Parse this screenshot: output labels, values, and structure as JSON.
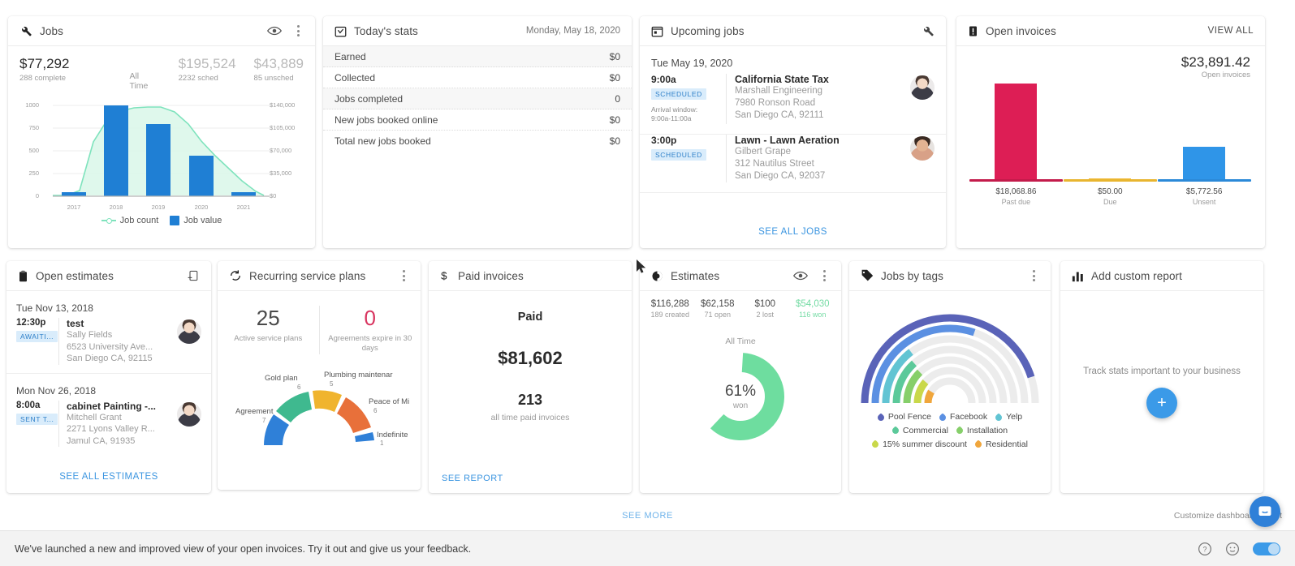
{
  "jobs": {
    "title": "Jobs",
    "icon": "wrench-icon",
    "eye_icon": "eye-icon",
    "menu_icon": "kebab-menu-icon",
    "stats": [
      {
        "value": "$77,292",
        "label": "288 complete"
      },
      {
        "value": "All Time",
        "label": ""
      },
      {
        "value": "$195,524",
        "label": "2232 sched"
      },
      {
        "value": "$43,889",
        "label": "85 unsched"
      }
    ],
    "stat_primary_value": "$77,292",
    "stat_primary_label": "288 complete",
    "stat_period": "All Time",
    "stat_sched_value": "$195,524",
    "stat_sched_label": "2232 sched",
    "stat_unsched_value": "$43,889",
    "stat_unsched_label": "85 unsched",
    "legend": {
      "line": "Job count",
      "bar": "Job value"
    }
  },
  "today": {
    "title": "Today's stats",
    "icon": "calendar-check-icon",
    "date": "Monday, May 18, 2020",
    "rows": [
      {
        "label": "Earned",
        "value": "$0"
      },
      {
        "label": "Collected",
        "value": "$0"
      },
      {
        "label": "Jobs completed",
        "value": "0"
      },
      {
        "label": "New jobs booked online",
        "value": "$0"
      },
      {
        "label": "Total new jobs booked",
        "value": "$0"
      }
    ]
  },
  "upcoming": {
    "title": "Upcoming jobs",
    "icon": "calendar-icon",
    "action_icon": "wrench-icon",
    "day": "Tue May 19, 2020",
    "items": [
      {
        "time": "9:00a",
        "status": "SCHEDULED",
        "arrival_label": "Arrival window:",
        "arrival_window": "9:00a-11:00a",
        "title": "California State Tax",
        "customer": "Marshall Engineering",
        "address1": "7980 Ronson Road",
        "address2": "San Diego CA, 92111"
      },
      {
        "time": "3:00p",
        "status": "SCHEDULED",
        "arrival_label": "",
        "arrival_window": "",
        "title": "Lawn - Lawn Aeration",
        "customer": "Gilbert Grape",
        "address1": "312 Nautilus Street",
        "address2": "San Diego CA, 92037"
      }
    ],
    "link": "SEE ALL JOBS"
  },
  "invoices": {
    "title": "Open invoices",
    "icon": "invoice-alert-icon",
    "view_all": "VIEW ALL",
    "total_value": "$23,891.42",
    "total_label": "Open invoices",
    "bars": [
      {
        "value": "$18,068.86",
        "label": "Past due",
        "color": "#dd1e55",
        "height": 118
      },
      {
        "value": "$50.00",
        "label": "Due",
        "color": "#f0bb3c",
        "height": 1
      },
      {
        "value": "$5,772.56",
        "label": "Unsent",
        "color": "#2f95e8",
        "height": 40
      }
    ]
  },
  "open_estimates": {
    "title": "Open estimates",
    "icon": "clipboard-icon",
    "action_icon": "add-clipboard-icon",
    "groups": [
      {
        "day": "Tue Nov 13, 2018",
        "time": "12:30p",
        "status": "AWAITI...",
        "title": "test",
        "customer": "Sally Fields",
        "address1": "6523 University Ave...",
        "address2": "San Diego CA, 92115"
      },
      {
        "day": "Mon Nov 26, 2018",
        "time": "8:00a",
        "status": "SENT T...",
        "title": "cabinet Painting -...",
        "customer": "Mitchell Grant",
        "address1": "2271 Lyons Valley R...",
        "address2": "Jamul CA, 91935"
      }
    ],
    "link": "SEE ALL ESTIMATES"
  },
  "recurring": {
    "title": "Recurring service plans",
    "icon": "recurring-icon",
    "menu_icon": "kebab-menu-icon",
    "active_count": "25",
    "active_label": "Active service plans",
    "expiring_count": "0",
    "expiring_label": "Agreements expire in 30 days"
  },
  "paid": {
    "title": "Paid invoices",
    "icon": "dollar-icon",
    "heading": "Paid",
    "amount": "$81,602",
    "count": "213",
    "count_label": "all time paid invoices",
    "link": "SEE REPORT"
  },
  "estimates": {
    "title": "Estimates",
    "icon": "pie-icon",
    "eye_icon": "eye-icon",
    "menu_icon": "kebab-menu-icon",
    "stats": [
      {
        "value": "$116,288",
        "label": "189 created"
      },
      {
        "value": "$62,158",
        "label": "71 open"
      },
      {
        "value": "$100",
        "label": "2 lost"
      },
      {
        "value": "$54,030",
        "label": "116 won"
      }
    ],
    "period": "All Time",
    "donut_percent": "61%",
    "donut_label": "won"
  },
  "tags": {
    "title": "Jobs by tags",
    "icon": "tag-icon",
    "menu_icon": "kebab-menu-icon",
    "legend": [
      {
        "label": "Pool Fence",
        "color": "#5a63b8"
      },
      {
        "label": "Facebook",
        "color": "#5b90e2"
      },
      {
        "label": "Yelp",
        "color": "#62c4d3"
      },
      {
        "label": "Commercial",
        "color": "#5cc99a"
      },
      {
        "label": "Installation",
        "color": "#86cf6a"
      },
      {
        "label": "15% summer discount",
        "color": "#c9d84a"
      },
      {
        "label": "Residential",
        "color": "#f0a63c"
      }
    ]
  },
  "custom": {
    "title": "Add custom report",
    "icon": "bar-chart-icon",
    "text": "Track stats important to your business",
    "add_icon": "plus-icon"
  },
  "footer": {
    "see_more": "SEE MORE",
    "customize": "Customize dashboard layout",
    "chat_icon": "chat-bubble-icon"
  },
  "banner": {
    "text": "We've launched a new and improved view of your open invoices. Try it out and give us your feedback.",
    "help_icon": "help-circle-icon",
    "feedback_icon": "smiley-icon",
    "toggle_name": "new-view-toggle"
  },
  "chart_data": [
    {
      "type": "bar",
      "title": "Jobs",
      "categories": [
        "2017",
        "2018",
        "2019",
        "2020",
        "2021"
      ],
      "series": [
        {
          "name": "Job value",
          "values": [
            3000,
            140000,
            110000,
            61000,
            2500
          ],
          "type": "bar"
        },
        {
          "name": "Job count",
          "values": [
            5,
            830,
            995,
            545,
            75
          ],
          "type": "area"
        }
      ],
      "xlabel": "",
      "ylabel": "Job count",
      "ylim": [
        0,
        1000
      ],
      "y_ticks": [
        "0",
        "250",
        "500",
        "750",
        "1000"
      ],
      "y2label": "Job value",
      "y2lim": [
        0,
        140000
      ],
      "y2_ticks": [
        "$0",
        "$35,000",
        "$70,000",
        "$105,000",
        "$140,000"
      ],
      "grid": true,
      "legend_position": "bottom"
    },
    {
      "type": "bar",
      "title": "Open invoices",
      "categories": [
        "Past due",
        "Due",
        "Unsent"
      ],
      "values": [
        18068.86,
        50.0,
        5772.56
      ],
      "value_labels": [
        "$18,068.86",
        "$50.00",
        "$5,772.56"
      ],
      "colors": [
        "#dd1e55",
        "#f0bb3c",
        "#2f95e8"
      ],
      "total": "$23,891.42",
      "grid": false
    },
    {
      "type": "pie",
      "title": "Recurring service plans",
      "labels": [
        "Agreement",
        "Gold plan",
        "Plumbing maintenar",
        "Peace of Mi",
        "Indefinite"
      ],
      "values": [
        7,
        6,
        5,
        6,
        1
      ],
      "colors": [
        "#2f80d8",
        "#3fb98f",
        "#f0b42e",
        "#e8703a",
        "#2f80d8"
      ],
      "subtype": "semi-donut"
    },
    {
      "type": "pie",
      "title": "Estimates",
      "labels": [
        "won",
        "other"
      ],
      "values": [
        61,
        39
      ],
      "percent_label": "61%",
      "center_label": "won",
      "colors": [
        "#6edd9f",
        "#ffffff"
      ],
      "subtype": "donut"
    },
    {
      "type": "bar",
      "title": "Jobs by tags",
      "subtype": "radial",
      "categories": [
        "Pool Fence",
        "Facebook",
        "Yelp",
        "Commercial",
        "Installation",
        "15% summer discount",
        "Residential"
      ],
      "values": [
        100,
        74,
        30,
        26,
        22,
        18,
        10
      ],
      "colors": [
        "#5a63b8",
        "#5b90e2",
        "#62c4d3",
        "#5cc99a",
        "#86cf6a",
        "#c9d84a",
        "#f0a63c"
      ]
    }
  ]
}
